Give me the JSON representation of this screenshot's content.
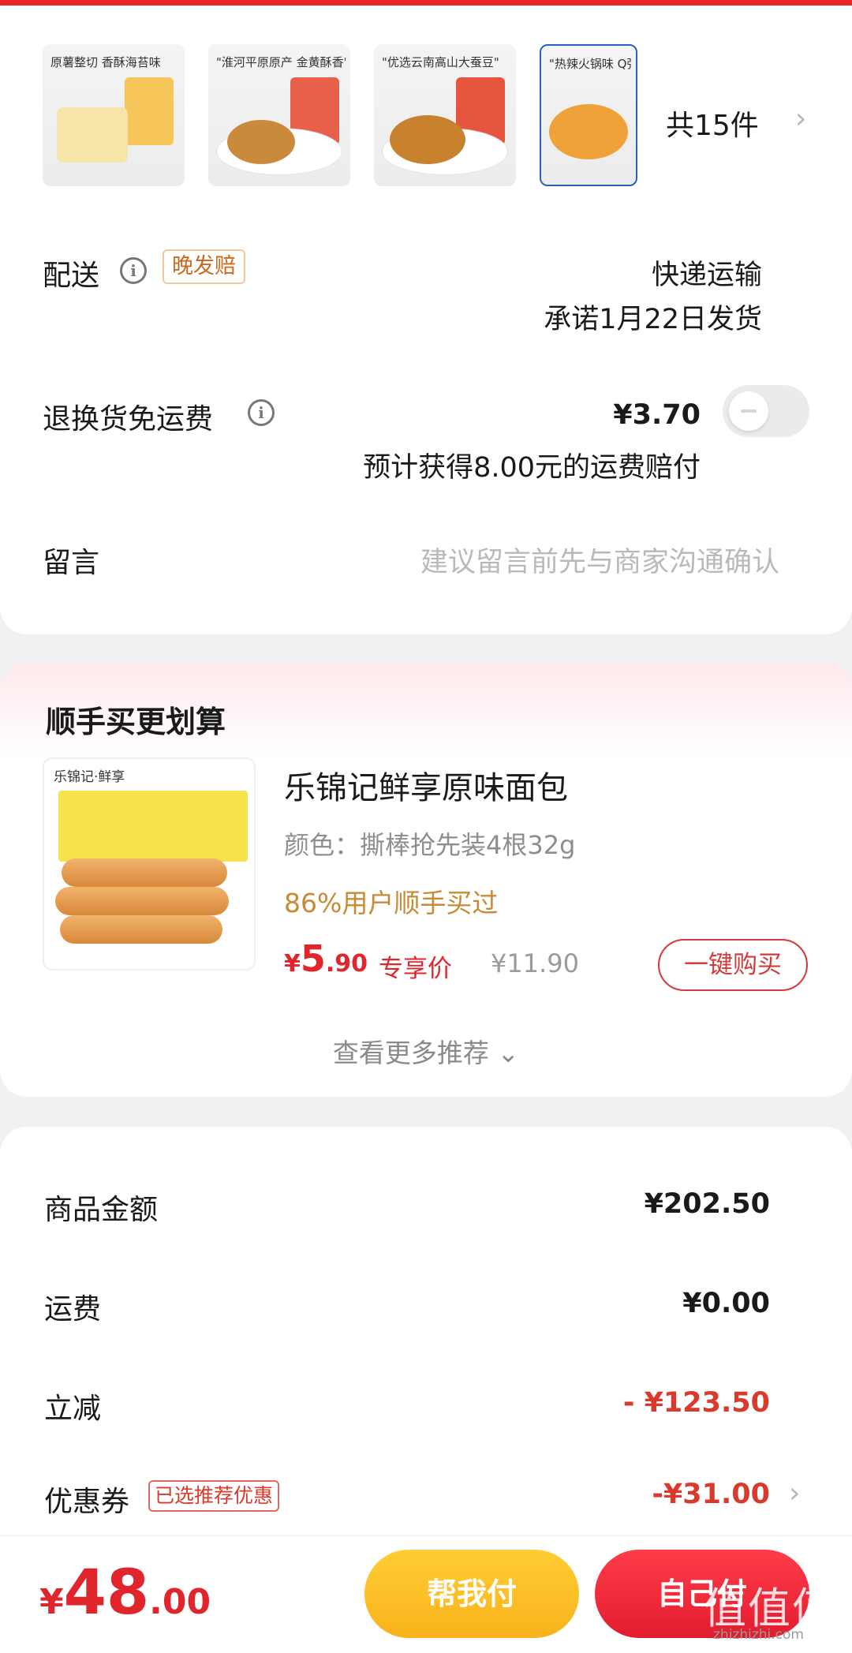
{
  "colors": {
    "accent_red": "#e0262c",
    "help_yellow": "#f9b21b",
    "social_gold": "#c78a35"
  },
  "products": {
    "thumbs": [
      {
        "caption": "原薯整切 香酥海苔味",
        "icon": "fries-product-image"
      },
      {
        "caption": "\"淮河平原原产 金黄酥香\"",
        "icon": "fried-peanut-product-image"
      },
      {
        "caption": "\"优选云南高山大蚕豆\"",
        "icon": "broad-bean-product-image"
      },
      {
        "caption": "\"热辣火锅味 Q弹\"",
        "icon": "quail-egg-product-image"
      }
    ],
    "count_label": "共15件"
  },
  "delivery": {
    "label": "配送",
    "tag": "晚发赔",
    "method": "快递运输",
    "promise": "承诺1月22日发货"
  },
  "return_shipping": {
    "label": "退换货免运费",
    "price": "¥3.70",
    "note": "预计获得8.00元的运费赔付",
    "enabled": false
  },
  "message": {
    "label": "留言",
    "placeholder": "建议留言前先与商家沟通确认"
  },
  "addon": {
    "title": "顺手买更划算",
    "brand_text": "乐锦记·鲜享",
    "product_name": "乐锦记鲜享原味面包",
    "spec": "颜色：撕棒抢先装4根32g",
    "social_proof": "86%用户顺手买过",
    "price_symbol": "¥",
    "price_int": "5",
    "price_dec": ".90",
    "price_tag": "专享价",
    "original_price": "¥11.90",
    "buy_label": "一键购买",
    "more_label": "查看更多推荐 ⌄"
  },
  "summary": {
    "items": [
      {
        "label": "商品金额",
        "value": "¥202.50"
      },
      {
        "label": "运费",
        "value": "¥0.00"
      },
      {
        "label": "立减",
        "value": "- ¥123.50"
      },
      {
        "label": "优惠券",
        "value": "-¥31.00"
      }
    ],
    "coupon_tag": "已选推荐优惠"
  },
  "footer": {
    "total_symbol": "¥",
    "total_int": "48",
    "total_dec": ".00",
    "help_pay": "帮我付",
    "self_pay": "自己付",
    "watermark_main": "值值值",
    "watermark_sub": "zhizhizhi.com"
  }
}
